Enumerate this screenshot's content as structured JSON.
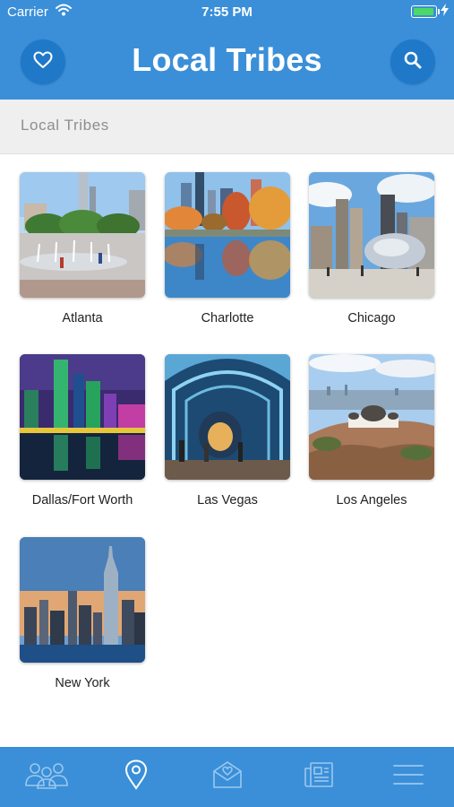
{
  "status_bar": {
    "carrier": "Carrier",
    "time": "7:55 PM"
  },
  "header": {
    "title": "Local Tribes",
    "favorites_icon": "heart-icon",
    "search_icon": "search-icon"
  },
  "section": {
    "title": "Local Tribes"
  },
  "cities": [
    {
      "name": "Atlanta"
    },
    {
      "name": "Charlotte"
    },
    {
      "name": "Chicago"
    },
    {
      "name": "Dallas/Fort Worth"
    },
    {
      "name": "Las Vegas"
    },
    {
      "name": "Los Angeles"
    },
    {
      "name": "New York"
    }
  ],
  "tabbar": {
    "tabs": [
      {
        "icon": "people-icon",
        "active": false
      },
      {
        "icon": "location-pin-icon",
        "active": true
      },
      {
        "icon": "mail-heart-icon",
        "active": false
      },
      {
        "icon": "newspaper-icon",
        "active": false
      },
      {
        "icon": "menu-icon",
        "active": false
      }
    ]
  },
  "colors": {
    "primary": "#3a8fd8",
    "button": "#1f78c8",
    "section_bg": "#efefef",
    "battery": "#4cd964"
  }
}
